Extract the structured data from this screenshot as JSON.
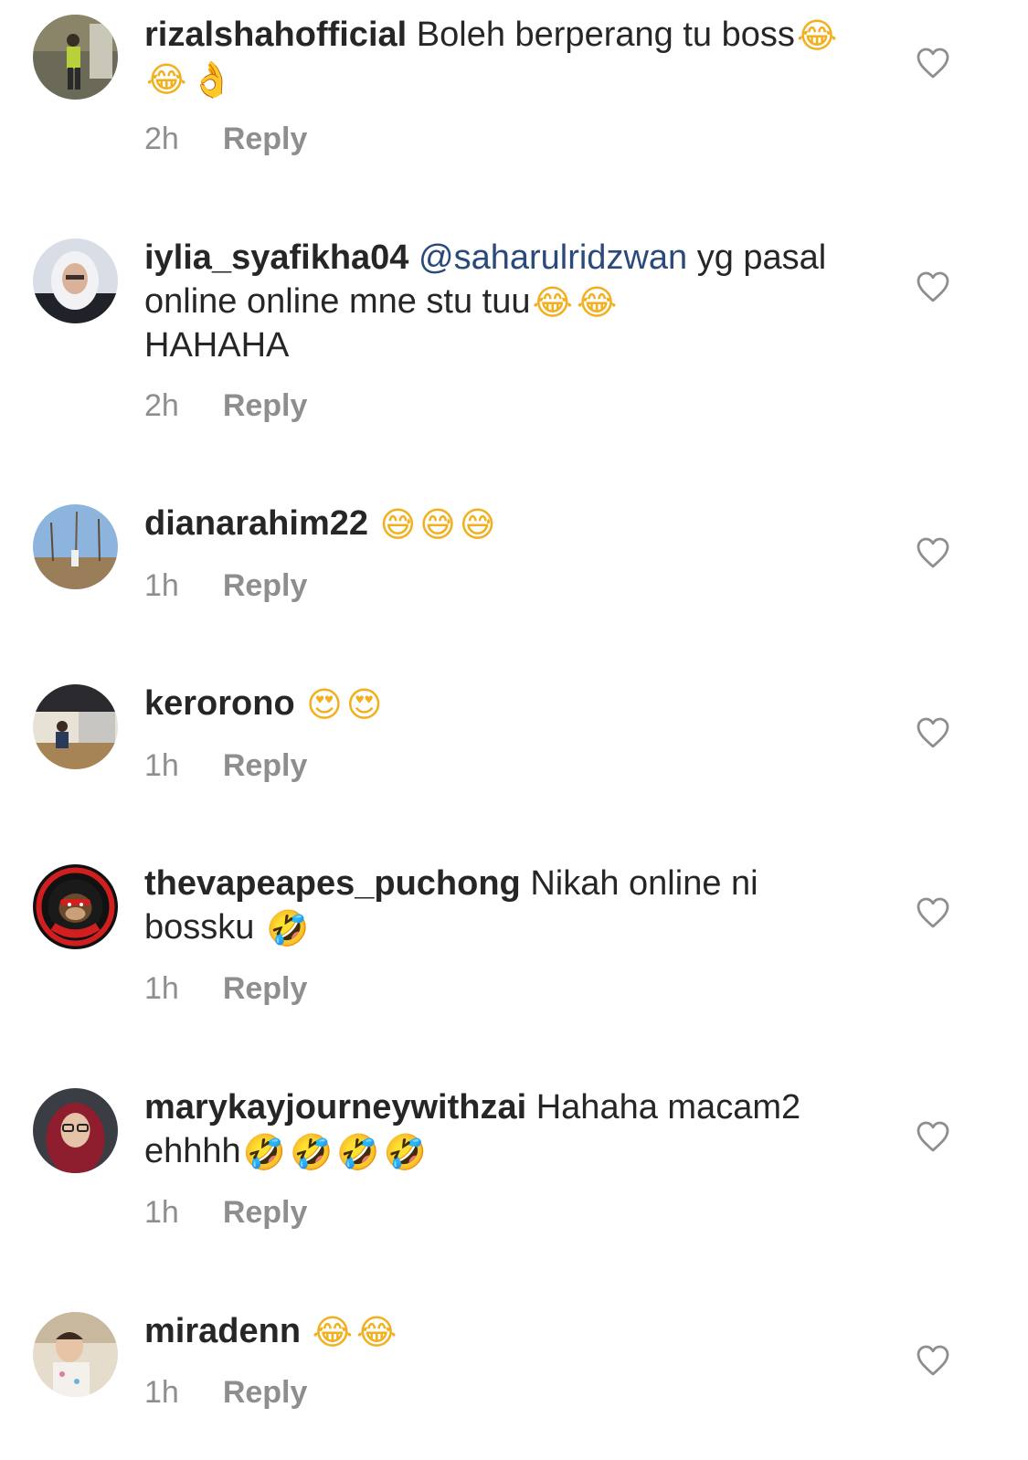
{
  "comments": [
    {
      "username": "rizalshahofficial",
      "mention": "",
      "text": "Boleh berperang tu boss",
      "emojis": [
        "😂",
        "😂",
        "👌"
      ],
      "trailing_text": "",
      "time": "2h",
      "reply_label": "Reply",
      "avatar_icon": "avatar-person-photo"
    },
    {
      "username": "iylia_syafikha04",
      "mention": "@saharulridzwan",
      "text": "yg pasal online online mne stu tuu",
      "emojis": [
        "😂",
        "😂"
      ],
      "trailing_text": "HAHAHA",
      "time": "2h",
      "reply_label": "Reply",
      "avatar_icon": "avatar-hijab-photo"
    },
    {
      "username": "dianarahim22",
      "mention": "",
      "text": "",
      "emojis": [
        "😅",
        "😅",
        "😅"
      ],
      "trailing_text": "",
      "time": "1h",
      "reply_label": "Reply",
      "avatar_icon": "avatar-landscape-photo"
    },
    {
      "username": "kerorono",
      "mention": "",
      "text": "",
      "emojis": [
        "😍",
        "😍"
      ],
      "trailing_text": "",
      "time": "1h",
      "reply_label": "Reply",
      "avatar_icon": "avatar-room-photo"
    },
    {
      "username": "thevapeapes_puchong",
      "mention": "",
      "text": "Nikah online ni bossku",
      "emojis": [
        "🤣"
      ],
      "trailing_text": "",
      "time": "1h",
      "reply_label": "Reply",
      "avatar_icon": "avatar-vape-apes-logo",
      "logo_text": "VAPE APES"
    },
    {
      "username": "marykayjourneywithzai",
      "mention": "",
      "text": "Hahaha macam2 ehhhh",
      "emojis": [
        "🤣",
        "🤣",
        "🤣",
        "🤣"
      ],
      "trailing_text": "",
      "time": "1h",
      "reply_label": "Reply",
      "avatar_icon": "avatar-hijab-glasses-photo"
    },
    {
      "username": "miradenn",
      "mention": "",
      "text": "",
      "emojis": [
        "😂",
        "😂"
      ],
      "trailing_text": "",
      "time": "1h",
      "reply_label": "Reply",
      "avatar_icon": "avatar-child-photo"
    }
  ],
  "colors": {
    "text": "#262626",
    "meta": "#8e8e8e",
    "mention": "#2b4a7c",
    "heart_outline": "#8e8e8e"
  },
  "icons": {
    "like": "heart-outline-icon"
  }
}
